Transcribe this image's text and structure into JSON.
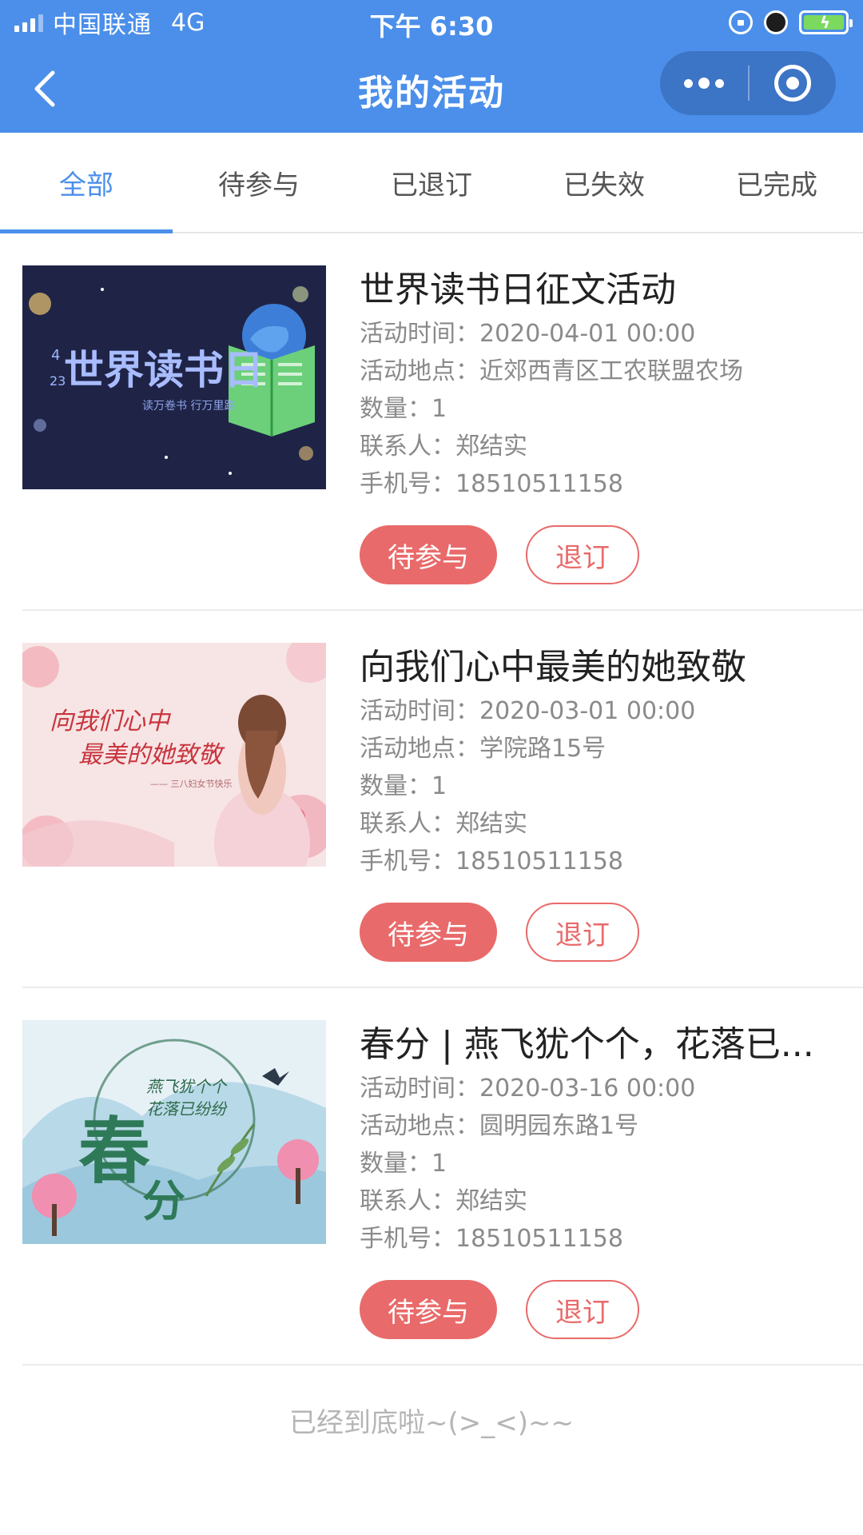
{
  "status_bar": {
    "carrier": "中国联通",
    "network": "4G",
    "time": "下午 6:30"
  },
  "nav": {
    "title": "我的活动"
  },
  "tabs": [
    {
      "label": "全部",
      "active": true
    },
    {
      "label": "待参与",
      "active": false
    },
    {
      "label": "已退订",
      "active": false
    },
    {
      "label": "已失效",
      "active": false
    },
    {
      "label": "已完成",
      "active": false
    }
  ],
  "colors": {
    "header": "#4b8fea",
    "accent_red": "#e96a6a"
  },
  "activities": [
    {
      "title": "世界读书日征文活动",
      "time_label": "活动时间：",
      "time": "2020-04-01 00:00",
      "place_label": "活动地点：",
      "place": "近郊西青区工农联盟农场",
      "qty_label": "数量：",
      "qty": "1",
      "contact_label": "联系人：",
      "contact": "郑结实",
      "phone_label": "手机号：",
      "phone": "18510511158",
      "btn_join": "待参与",
      "btn_cancel": "退订",
      "poster": {
        "big": "世界读书日",
        "date_top": "4",
        "date_bottom": "23",
        "slogan": "读万卷书 行万里路"
      }
    },
    {
      "title": "向我们心中最美的她致敬",
      "time_label": "活动时间：",
      "time": "2020-03-01 00:00",
      "place_label": "活动地点：",
      "place": "学院路15号",
      "qty_label": "数量：",
      "qty": "1",
      "contact_label": "联系人：",
      "contact": "郑结实",
      "phone_label": "手机号：",
      "phone": "18510511158",
      "btn_join": "待参与",
      "btn_cancel": "退订",
      "poster": {
        "line1": "向我们心中",
        "line2": "最美的她致敬",
        "sub": "—— 三八妇女节快乐"
      }
    },
    {
      "title": "春分 | 燕飞犹个个，花落已...",
      "time_label": "活动时间：",
      "time": "2020-03-16 00:00",
      "place_label": "活动地点：",
      "place": "圆明园东路1号",
      "qty_label": "数量：",
      "qty": "1",
      "contact_label": "联系人：",
      "contact": "郑结实",
      "phone_label": "手机号：",
      "phone": "18510511158",
      "btn_join": "待参与",
      "btn_cancel": "退订",
      "poster": {
        "big1": "春",
        "big2": "分",
        "poem1": "燕飞犹个个",
        "poem2": "花落已纷纷"
      }
    }
  ],
  "footer": {
    "note": "已经到底啦~(>_<)~~"
  }
}
